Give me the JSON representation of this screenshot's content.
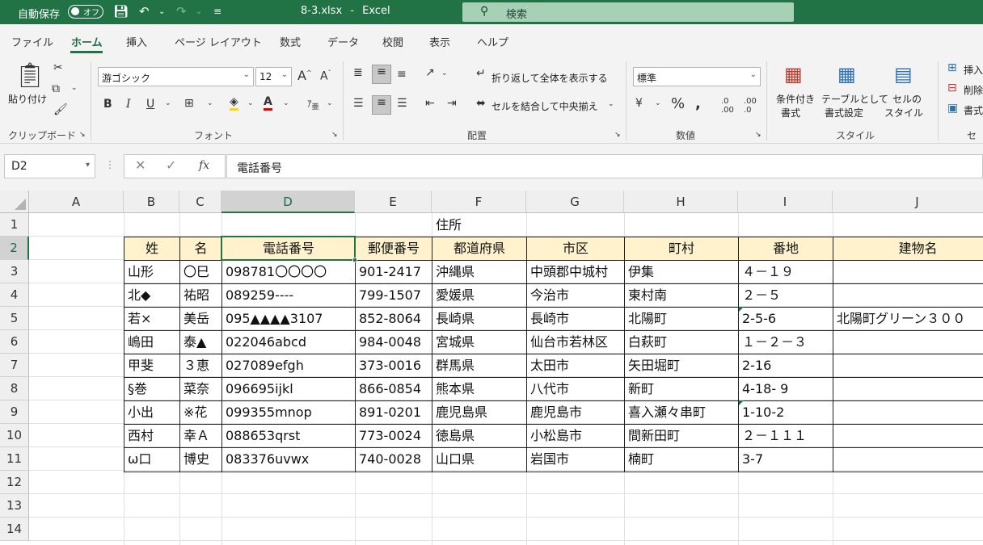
{
  "titlebar": {
    "autosave_label": "自動保存",
    "autosave_state": "オフ",
    "filename": "8-3.xlsx",
    "separator": "-",
    "app_name": "Excel",
    "search_placeholder": "検索"
  },
  "menu_tabs": [
    "ファイル",
    "ホーム",
    "挿入",
    "ページ レイアウト",
    "数式",
    "データ",
    "校閲",
    "表示",
    "ヘルプ"
  ],
  "active_tab": "ホーム",
  "ribbon": {
    "clipboard": {
      "paste_label": "貼り付け",
      "group_label": "クリップボード"
    },
    "font": {
      "font_name": "游ゴシック",
      "font_size": "12",
      "group_label": "フォント"
    },
    "alignment": {
      "wrap_text": "折り返して全体を表示する",
      "merge_center": "セルを結合して中央揃え",
      "group_label": "配置"
    },
    "number": {
      "format": "標準",
      "group_label": "数値"
    },
    "styles": {
      "conditional_1": "条件付き",
      "conditional_2": "書式",
      "table_1": "テーブルとして",
      "table_2": "書式設定",
      "cell_1": "セルの",
      "cell_2": "スタイル",
      "group_label": "スタイル"
    },
    "cells": {
      "insert": "挿入",
      "delete": "削除",
      "format": "書式",
      "group_label": "セル"
    }
  },
  "formula_bar": {
    "name_box": "D2",
    "content": "電話番号"
  },
  "columns": [
    "A",
    "B",
    "C",
    "D",
    "E",
    "F",
    "G",
    "H",
    "I",
    "J"
  ],
  "rows": [
    "1",
    "2",
    "3",
    "4",
    "5",
    "6",
    "7",
    "8",
    "9",
    "10",
    "11",
    "12",
    "13",
    "14"
  ],
  "selected_cell": "D2",
  "sheet": {
    "row1": {
      "F": "住所"
    },
    "headers": [
      "姓",
      "名",
      "電話番号",
      "郵便番号",
      "都道府県",
      "市区",
      "町村",
      "番地",
      "建物名"
    ],
    "data": [
      [
        "山形",
        "〇巳",
        "098781〇〇〇〇",
        "901-2417",
        "沖縄県",
        "中頭郡中城村",
        "伊集",
        "４－１９",
        ""
      ],
      [
        "北◆",
        "祐昭",
        "089259----",
        "799-1507",
        "愛媛県",
        "今治市",
        "東村南",
        "２－５",
        ""
      ],
      [
        "若×",
        "美岳",
        "095▲▲▲▲3107",
        "852-8064",
        "長崎県",
        "長崎市",
        "北陽町",
        "2-5-6",
        "北陽町グリーン３００"
      ],
      [
        "嶋田",
        "泰▲",
        "022046abcd",
        "984-0048",
        "宮城県",
        "仙台市若林区",
        "白萩町",
        "１－２－３",
        ""
      ],
      [
        "甲斐",
        "３恵",
        "027089efgh",
        "373-0016",
        "群馬県",
        "太田市",
        "矢田堀町",
        "2-16",
        ""
      ],
      [
        "§巻",
        "菜奈",
        "096695ijkl",
        "866-0854",
        "熊本県",
        "八代市",
        "新町",
        "4-18- 9",
        ""
      ],
      [
        "小出",
        "※花",
        "099355mnop",
        "891-0201",
        "鹿児島県",
        "鹿児島市",
        "喜入瀬々串町",
        "1-10-2",
        ""
      ],
      [
        "西村",
        "幸Ａ",
        "088653qrst",
        "773-0024",
        "徳島県",
        "小松島市",
        "間新田町",
        "２－１１１",
        ""
      ],
      [
        "ω口",
        "博史",
        "083376uvwx",
        "740-0028",
        "山口県",
        "岩国市",
        "楠町",
        "3-7",
        ""
      ]
    ]
  },
  "colors": {
    "excel_green": "#217346",
    "header_fill": "#fff2cc"
  }
}
